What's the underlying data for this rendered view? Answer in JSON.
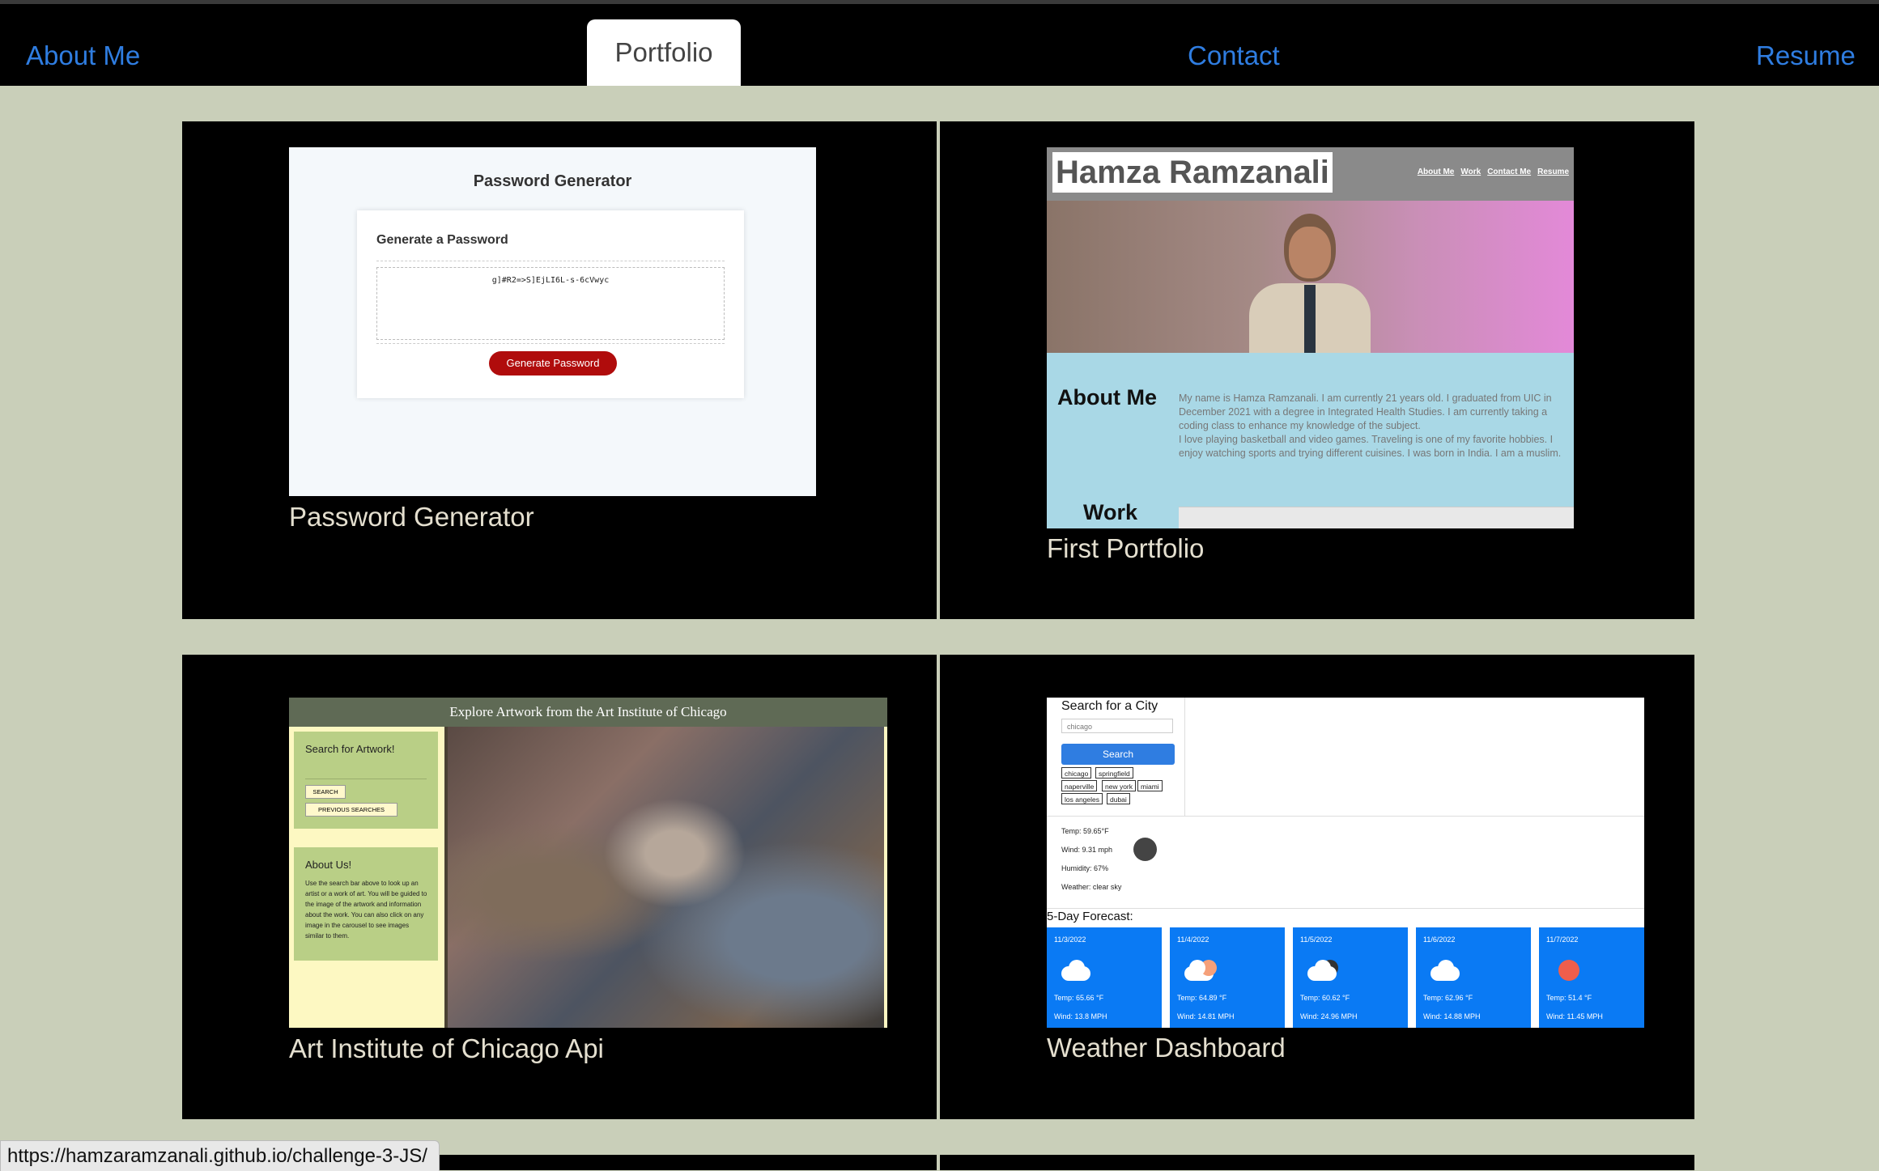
{
  "nav": {
    "items": [
      {
        "label": "About Me"
      },
      {
        "label": "Portfolio",
        "active": true
      },
      {
        "label": "Contact"
      },
      {
        "label": "Resume"
      }
    ],
    "link_color": "#2f7de1"
  },
  "projects": [
    {
      "title": "Password Generator",
      "preview": {
        "heading": "Password Generator",
        "card_title": "Generate a Password",
        "password": "g]#R2=>S]EjLI6L-s-6cVwyc",
        "button": "Generate Password"
      }
    },
    {
      "title": "First Portfolio",
      "preview": {
        "name": "Hamza Ramzanali",
        "links": [
          "About Me",
          "Work",
          "Contact Me",
          "Resume"
        ],
        "about_heading": "About Me",
        "about_text": "My name is Hamza Ramzanali. I am currently 21 years old. I graduated from UIC in December 2021 with a degree in Integrated Health Studies. I am currently taking a coding class to enhance my knowledge of the subject.",
        "about_text_2": "I love playing basketball and video games. Traveling is one of my favorite hobbies. I enjoy watching sports and trying different cuisines. I was born in India. I am a muslim.",
        "work_heading": "Work"
      }
    },
    {
      "title": "Art Institute of Chicago Api",
      "preview": {
        "banner": "Explore Artwork from the Art Institute of Chicago",
        "search_title": "Search for Artwork!",
        "search_button": "SEARCH",
        "previous_button": "PREVIOUS SEARCHES",
        "about_title": "About Us!",
        "about_text": "Use the search bar above to look up an artist or a work of art. You will be guided to the image of the artwork and information about the work. You can also click on any image in the carousel to see images similar to them."
      }
    },
    {
      "title": "Weather Dashboard",
      "preview": {
        "search_title": "Search for a City",
        "input_value": "chicago",
        "search_button": "Search",
        "cities": [
          "chicago",
          "springfield",
          "naperville",
          "new york",
          "miami",
          "los angeles",
          "dubai"
        ],
        "current": {
          "temp": "Temp: 59.65°F",
          "wind": "Wind: 9.31 mph",
          "humidity": "Humidity: 67%",
          "weather": "Weather: clear sky"
        },
        "forecast_title": "5-Day Forecast:",
        "forecast": [
          {
            "date": "11/3/2022",
            "temp": "Temp: 65.66 °F",
            "wind": "Wind: 13.8 MPH",
            "icon": "cloud-icon"
          },
          {
            "date": "11/4/2022",
            "temp": "Temp: 64.89 °F",
            "wind": "Wind: 14.81 MPH",
            "icon": "cloud-sun-icon"
          },
          {
            "date": "11/5/2022",
            "temp": "Temp: 60.62 °F",
            "wind": "Wind: 24.96 MPH",
            "icon": "dark-cloud-icon"
          },
          {
            "date": "11/6/2022",
            "temp": "Temp: 62.96 °F",
            "wind": "Wind: 14.88 MPH",
            "icon": "cloud-icon"
          },
          {
            "date": "11/7/2022",
            "temp": "Temp: 51.4 °F",
            "wind": "Wind: 11.45 MPH",
            "icon": "sun-icon"
          }
        ]
      }
    }
  ],
  "status_url": "https://hamzaramzanali.github.io/challenge-3-JS/"
}
